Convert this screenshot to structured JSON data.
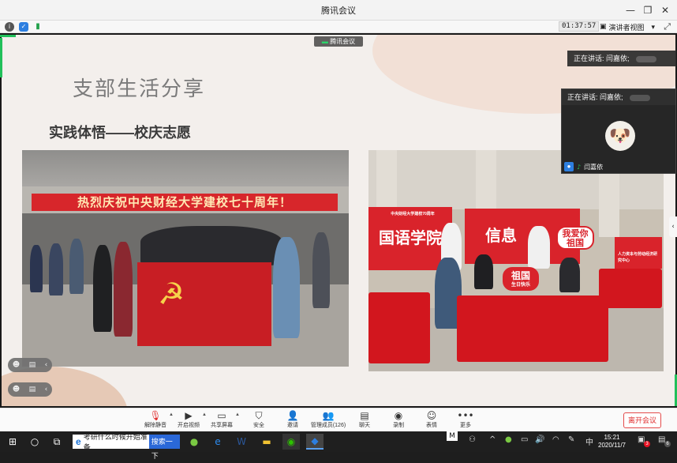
{
  "window": {
    "title": "腾讯会议",
    "controls": [
      "minimize",
      "restore",
      "close"
    ]
  },
  "infobar": {
    "icons": [
      "info-icon",
      "shield-icon",
      "signal-icon"
    ],
    "timer": "01:37:57",
    "view_label": "演讲者视图",
    "view_caret": "▾"
  },
  "share": {
    "meeting_tag": "腾讯会议",
    "slide_title": "支部生活分享",
    "slide_subtitle": "实践体悟——校庆志愿",
    "photo1_banner": "热烈庆祝中央财经大学建校七十周年！",
    "photo2_board_left": "国语学院",
    "photo2_board_mid": "信息",
    "photo2_small_text": "中央财经大学建校70周年",
    "photo2_bubble1": "我爱你 祖国",
    "photo2_bubble2": "祖国",
    "photo2_bubble2_sub": "生日快乐",
    "photo2_board_right": "人力资本与劳动经济研究中心"
  },
  "speaker": {
    "strip_label": "正在讲话: 闫嘉依;",
    "card_label": "正在讲话: 闫嘉依;",
    "name": "闫嘉依"
  },
  "toolbar": {
    "items": [
      {
        "label": "解除静音",
        "icon": "mic-muted-icon"
      },
      {
        "label": "开启视频",
        "icon": "camera-off-icon"
      },
      {
        "label": "共享屏幕",
        "icon": "share-screen-icon"
      },
      {
        "label": "安全",
        "icon": "shield-icon"
      },
      {
        "label": "邀请",
        "icon": "invite-icon"
      },
      {
        "label": "管理成员(126)",
        "icon": "members-icon"
      },
      {
        "label": "聊天",
        "icon": "chat-icon"
      },
      {
        "label": "录制",
        "icon": "record-icon"
      },
      {
        "label": "表情",
        "icon": "emoji-icon"
      },
      {
        "label": "更多",
        "icon": "more-icon"
      }
    ],
    "leave_label": "离开会议"
  },
  "taskbar": {
    "search_text": "考研什么时候开始准备",
    "search_button": "搜索一下",
    "ime": "中",
    "time": "15:21",
    "date": "2020/11/7",
    "notification_count": "6",
    "app_badge": "3"
  },
  "colors": {
    "accent_green": "#21c05a",
    "leave_red": "#e02f2f",
    "flag_red": "#c81e24"
  }
}
